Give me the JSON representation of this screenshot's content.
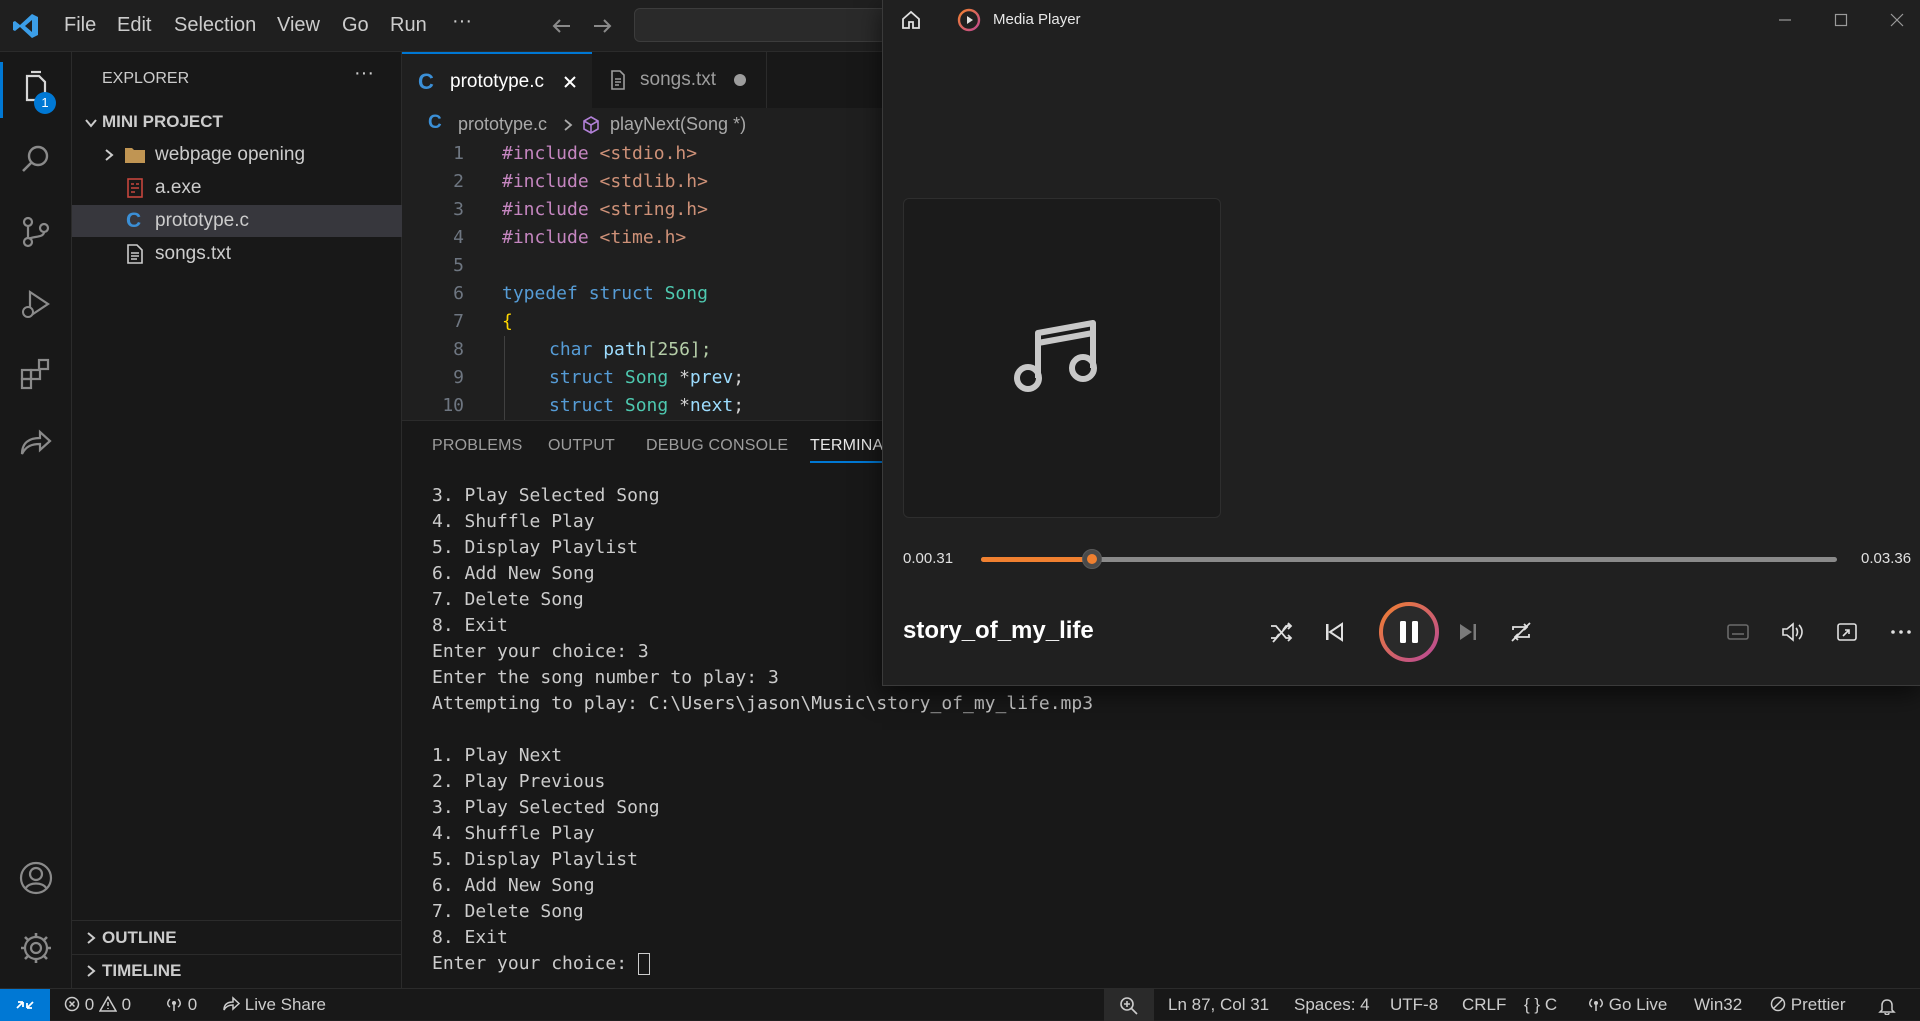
{
  "menu": {
    "file": "File",
    "edit": "Edit",
    "selection": "Selection",
    "view": "View",
    "go": "Go",
    "run": "Run",
    "more": "···"
  },
  "activity": {
    "badge": "1"
  },
  "sidebar": {
    "title": "EXPLORER",
    "more": "···",
    "project": "MINI PROJECT",
    "items": [
      {
        "label": "webpage opening"
      },
      {
        "label": "a.exe"
      },
      {
        "label": "prototype.c"
      },
      {
        "label": "songs.txt"
      }
    ],
    "outline": "OUTLINE",
    "timeline": "TIMELINE"
  },
  "editor": {
    "tabs": [
      {
        "label": "prototype.c"
      },
      {
        "label": "songs.txt"
      }
    ],
    "breadcrumb": {
      "file": "prototype.c",
      "symbol": "playNext(Song *)"
    },
    "lines": [
      {
        "n": "1"
      },
      {
        "n": "2"
      },
      {
        "n": "3"
      },
      {
        "n": "4"
      },
      {
        "n": "5"
      },
      {
        "n": "6"
      },
      {
        "n": "7"
      },
      {
        "n": "8"
      },
      {
        "n": "9"
      },
      {
        "n": "10"
      }
    ],
    "code": {
      "inc": "#include",
      "h1": "<stdio.h>",
      "h2": "<stdlib.h>",
      "h3": "<string.h>",
      "h4": "<time.h>",
      "typedef": "typedef",
      "struct": "struct",
      "Song": "Song",
      "brace": "{",
      "char": "char",
      "path": "path",
      "arr": "[256];",
      "star": "*",
      "prev": "prev",
      "next": "next",
      "semi": ";"
    }
  },
  "panel": {
    "tabs": {
      "problems": "PROBLEMS",
      "output": "OUTPUT",
      "debug": "DEBUG CONSOLE",
      "terminal": "TERMINAL"
    },
    "terminal": [
      "3. Play Selected Song",
      "4. Shuffle Play",
      "5. Display Playlist",
      "6. Add New Song",
      "7. Delete Song",
      "8. Exit",
      "Enter your choice: 3",
      "Enter the song number to play: 3",
      "Attempting to play: C:\\Users\\jason\\Music\\story_of_my_life.mp3",
      "",
      "1. Play Next",
      "2. Play Previous",
      "3. Play Selected Song",
      "4. Shuffle Play",
      "5. Display Playlist",
      "6. Add New Song",
      "7. Delete Song",
      "8. Exit",
      "Enter your choice: "
    ]
  },
  "statusbar": {
    "errors": "0",
    "warnings": "0",
    "ports": "0",
    "liveshare": "Live Share",
    "position": "Ln 87, Col 31",
    "spaces": "Spaces: 4",
    "encoding": "UTF-8",
    "eol": "CRLF",
    "lang_braces": "{ }",
    "language": "C",
    "golive": "Go Live",
    "platform": "Win32",
    "prettier": "Prettier"
  },
  "player": {
    "title": "Media Player",
    "elapsed": "0.00.31",
    "total": "0.03.36",
    "progress": 0.1298,
    "track": "story_of_my_life",
    "accent": "#f08030"
  }
}
